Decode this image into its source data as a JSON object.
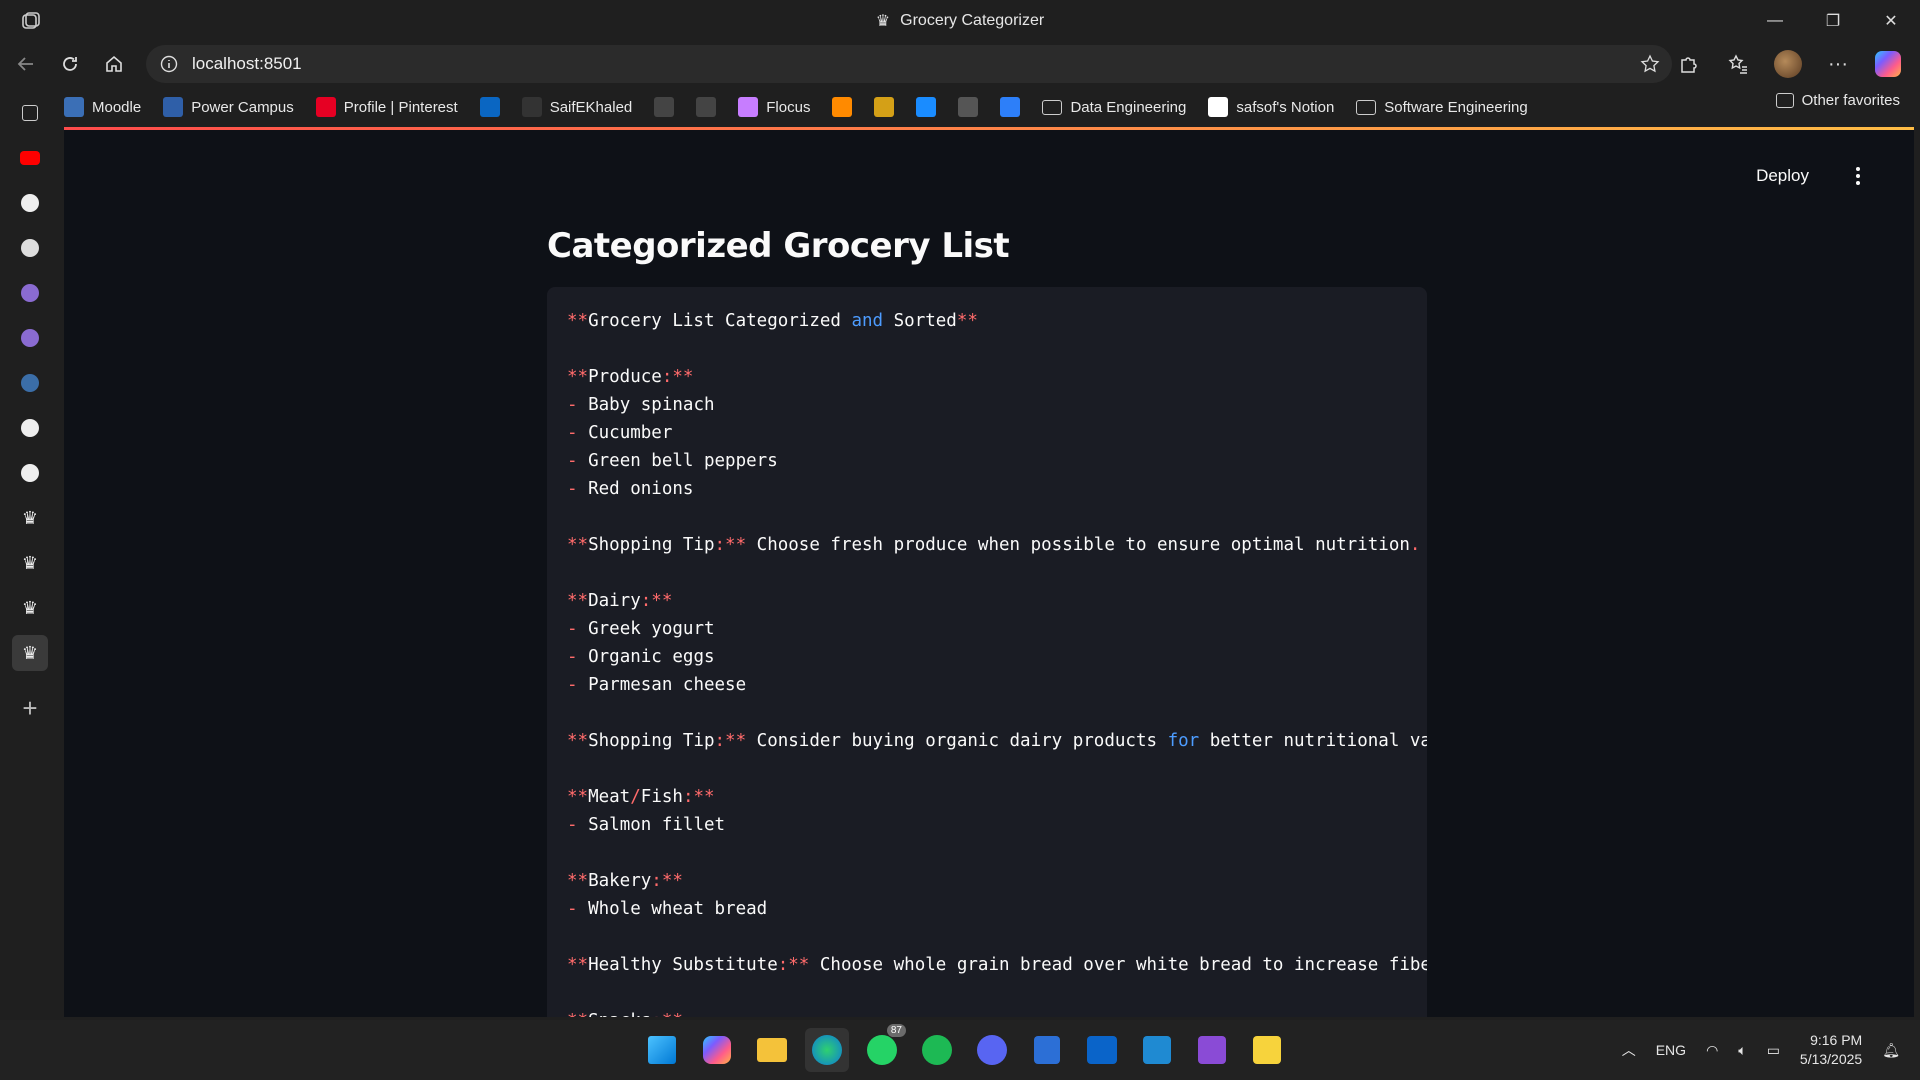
{
  "window": {
    "title": "Grocery Categorizer"
  },
  "browser": {
    "url": "localhost:8501",
    "favorites": [
      {
        "label": "Moodle",
        "icon": "moodle-icon",
        "color": "#3b6fb6"
      },
      {
        "label": "Power Campus",
        "icon": "power-campus-icon",
        "color": "#2f5fa8"
      },
      {
        "label": "Profile | Pinterest",
        "icon": "pinterest-icon",
        "color": "#e60023"
      },
      {
        "label": "",
        "icon": "linkedin-icon",
        "color": "#0a66c2"
      },
      {
        "label": "SaifEKhaled",
        "icon": "github-icon",
        "color": "#333333"
      },
      {
        "label": "",
        "icon": "openai-icon",
        "color": "#444444"
      },
      {
        "label": "",
        "icon": "slashed-circle-icon",
        "color": "#444444"
      },
      {
        "label": "Flocus",
        "icon": "flocus-icon",
        "color": "#c77dff"
      },
      {
        "label": "",
        "icon": "x-orange-icon",
        "color": "#ff8a00"
      },
      {
        "label": "",
        "icon": "arrow-app-icon",
        "color": "#d4a017"
      },
      {
        "label": "",
        "icon": "play-blue-icon",
        "color": "#1a8cff"
      },
      {
        "label": "",
        "icon": "swirl-icon",
        "color": "#555555"
      },
      {
        "label": "",
        "icon": "calendar-icon",
        "color": "#2d7ff9"
      },
      {
        "label": "Data Engineering",
        "icon": "folder-icon",
        "color": "#cccccc"
      },
      {
        "label": "safsof's Notion",
        "icon": "notion-icon",
        "color": "#ffffff"
      },
      {
        "label": "Software Engineering",
        "icon": "folder-icon",
        "color": "#cccccc"
      }
    ],
    "other_favorites": "Other favorites"
  },
  "sidebar": {
    "items": [
      {
        "icon": "tabs-icon"
      },
      {
        "icon": "youtube-icon"
      },
      {
        "icon": "github-icon"
      },
      {
        "icon": "openai-icon"
      },
      {
        "icon": "app-purple-icon"
      },
      {
        "icon": "app-purple-icon"
      },
      {
        "icon": "flutter-icon"
      },
      {
        "icon": "power-icon"
      },
      {
        "icon": "github-icon"
      },
      {
        "icon": "crown-icon"
      },
      {
        "icon": "crown-icon"
      },
      {
        "icon": "crown-icon"
      },
      {
        "icon": "crown-icon"
      },
      {
        "icon": "add-icon"
      }
    ]
  },
  "app": {
    "deploy_label": "Deploy",
    "title": "Categorized Grocery List",
    "lines": [
      [
        [
          "r",
          "**"
        ],
        [
          "t",
          "Grocery List Categorized "
        ],
        [
          "b",
          "and"
        ],
        [
          "t",
          " Sorted"
        ],
        [
          "r",
          "**"
        ]
      ],
      [],
      [
        [
          "r",
          "**"
        ],
        [
          "t",
          "Produce"
        ],
        [
          "r",
          ":**"
        ]
      ],
      [
        [
          "r",
          "-"
        ],
        [
          "t",
          " Baby spinach"
        ]
      ],
      [
        [
          "r",
          "-"
        ],
        [
          "t",
          " Cucumber"
        ]
      ],
      [
        [
          "r",
          "-"
        ],
        [
          "t",
          " Green bell peppers"
        ]
      ],
      [
        [
          "r",
          "-"
        ],
        [
          "t",
          " Red onions"
        ]
      ],
      [],
      [
        [
          "r",
          "**"
        ],
        [
          "t",
          "Shopping Tip"
        ],
        [
          "r",
          ":**"
        ],
        [
          "t",
          " Choose fresh produce when possible to ensure optimal nutrition"
        ],
        [
          "r",
          "."
        ]
      ],
      [],
      [
        [
          "r",
          "**"
        ],
        [
          "t",
          "Dairy"
        ],
        [
          "r",
          ":**"
        ]
      ],
      [
        [
          "r",
          "-"
        ],
        [
          "t",
          " Greek yogurt"
        ]
      ],
      [
        [
          "r",
          "-"
        ],
        [
          "t",
          " Organic eggs"
        ]
      ],
      [
        [
          "r",
          "-"
        ],
        [
          "t",
          " Parmesan cheese"
        ]
      ],
      [],
      [
        [
          "r",
          "**"
        ],
        [
          "t",
          "Shopping Tip"
        ],
        [
          "r",
          ":**"
        ],
        [
          "t",
          " Consider buying organic dairy products "
        ],
        [
          "b",
          "for"
        ],
        [
          "t",
          " better nutritional va"
        ]
      ],
      [],
      [
        [
          "r",
          "**"
        ],
        [
          "t",
          "Meat"
        ],
        [
          "r",
          "/"
        ],
        [
          "t",
          "Fish"
        ],
        [
          "r",
          ":**"
        ]
      ],
      [
        [
          "r",
          "-"
        ],
        [
          "t",
          " Salmon fillet"
        ]
      ],
      [],
      [
        [
          "r",
          "**"
        ],
        [
          "t",
          "Bakery"
        ],
        [
          "r",
          ":**"
        ]
      ],
      [
        [
          "r",
          "-"
        ],
        [
          "t",
          " Whole wheat bread"
        ]
      ],
      [],
      [
        [
          "r",
          "**"
        ],
        [
          "t",
          "Healthy Substitute"
        ],
        [
          "r",
          ":**"
        ],
        [
          "t",
          " Choose whole grain bread over white bread to increase fibe"
        ]
      ],
      [],
      [
        [
          "r",
          "**"
        ],
        [
          "t",
          "Snacks"
        ],
        [
          "r",
          ":**"
        ]
      ]
    ]
  },
  "taskbar": {
    "apps": [
      {
        "icon": "windows-start-icon",
        "active": false
      },
      {
        "icon": "copilot-icon",
        "active": false
      },
      {
        "icon": "file-explorer-icon",
        "active": false
      },
      {
        "icon": "edge-icon",
        "active": true
      },
      {
        "icon": "whatsapp-icon",
        "active": false,
        "badge": "87"
      },
      {
        "icon": "spotify-icon",
        "active": false
      },
      {
        "icon": "discord-icon",
        "active": false
      },
      {
        "icon": "shield-app-icon",
        "active": false
      },
      {
        "icon": "outlook-icon",
        "active": false
      },
      {
        "icon": "vscode-icon",
        "active": false
      },
      {
        "icon": "visual-studio-icon",
        "active": false
      },
      {
        "icon": "sticky-notes-icon",
        "active": false
      }
    ],
    "language": "ENG",
    "time": "9:16 PM",
    "date": "5/13/2025"
  }
}
